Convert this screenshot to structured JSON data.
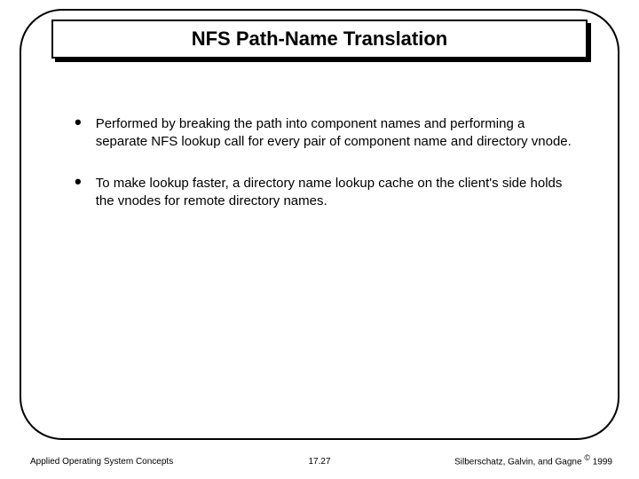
{
  "title": "NFS Path-Name Translation",
  "bullets": [
    "Performed by breaking the path into component names and performing a separate NFS lookup call for every pair of component name and directory vnode.",
    "To make lookup faster, a directory name lookup cache on the client's side holds the vnodes for remote directory names."
  ],
  "footer": {
    "left": "Applied Operating System Concepts",
    "center": "17.27",
    "right_prefix": "Silberschatz, Galvin, and Gagne ",
    "right_symbol": "©",
    "right_year": " 1999"
  }
}
